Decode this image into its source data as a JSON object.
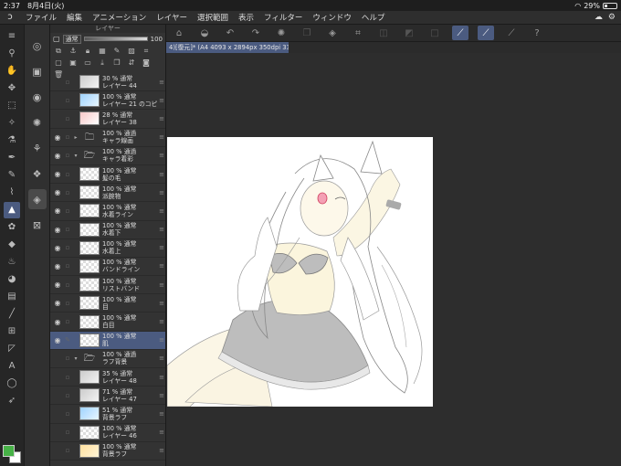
{
  "status": {
    "time": "2:37",
    "date": "8月4日(火)",
    "battery": "29%",
    "battery_level": 0.29
  },
  "menu": [
    "ファイル",
    "編集",
    "アニメーション",
    "レイヤー",
    "選択範囲",
    "表示",
    "フィルター",
    "ウィンドウ",
    "ヘルプ"
  ],
  "layer_panel": {
    "title": "レイヤー",
    "blend_mode": "通常",
    "opacity": "100"
  },
  "layers": [
    {
      "info": "30 % 通常",
      "name": "レイヤー 44",
      "visible": false,
      "thumb": "gray"
    },
    {
      "info": "100 % 通常",
      "name": "レイヤー 21 のコピー",
      "visible": false,
      "thumb": "blue"
    },
    {
      "info": "28 % 通常",
      "name": "レイヤー 38",
      "visible": false,
      "thumb": "pink"
    },
    {
      "info": "100 % 通過",
      "name": "キャラ線画",
      "visible": true,
      "thumb": "folder",
      "folder": true
    },
    {
      "info": "100 % 通過",
      "name": "キャラ着彩",
      "visible": true,
      "thumb": "folder",
      "folder": true,
      "open": true
    },
    {
      "info": "100 % 通常",
      "name": "髪の毛",
      "visible": true,
      "thumb": "check"
    },
    {
      "info": "100 % 通常",
      "name": "派腕物",
      "visible": true,
      "thumb": "check"
    },
    {
      "info": "100 % 通常",
      "name": "水着ライン",
      "visible": true,
      "thumb": "check"
    },
    {
      "info": "100 % 通常",
      "name": "水着下",
      "visible": true,
      "thumb": "check"
    },
    {
      "info": "100 % 通常",
      "name": "水着上",
      "visible": true,
      "thumb": "check"
    },
    {
      "info": "100 % 通常",
      "name": "バンドライン",
      "visible": true,
      "thumb": "check"
    },
    {
      "info": "100 % 通常",
      "name": "リストバンド",
      "visible": true,
      "thumb": "check"
    },
    {
      "info": "100 % 通常",
      "name": "目",
      "visible": true,
      "thumb": "check"
    },
    {
      "info": "100 % 通常",
      "name": "白目",
      "visible": true,
      "thumb": "check"
    },
    {
      "info": "100 % 通常",
      "name": "肌",
      "visible": true,
      "thumb": "check",
      "selected": true
    },
    {
      "info": "100 % 通過",
      "name": "ラフ背景",
      "visible": false,
      "thumb": "folder",
      "folder": true,
      "open": true
    },
    {
      "info": "35 % 通常",
      "name": "レイヤー 48",
      "visible": false,
      "thumb": "gray"
    },
    {
      "info": "71 % 通常",
      "name": "レイヤー 47",
      "visible": false,
      "thumb": "gray"
    },
    {
      "info": "51 % 通常",
      "name": "背景ラフ",
      "visible": false,
      "thumb": "blue"
    },
    {
      "info": "100 % 通常",
      "name": "レイヤー 46",
      "visible": false,
      "thumb": "check"
    },
    {
      "info": "100 % 通常",
      "name": "背景ラフ",
      "visible": false,
      "thumb": "yellow"
    }
  ],
  "document": {
    "tab_label": "4)[復元]* (A4 4093 x 2894px 350dpi 33.1%)"
  },
  "colors": {
    "foreground": "#47b247",
    "background": "#ffffff",
    "accent": "#4b5b80"
  }
}
